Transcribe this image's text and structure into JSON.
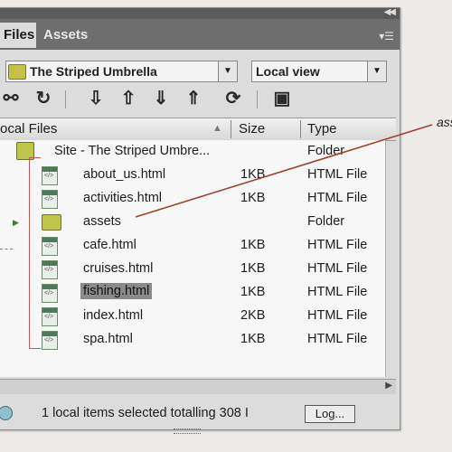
{
  "panel": {
    "tabs": [
      {
        "label": "Files"
      },
      {
        "label": "Assets"
      }
    ],
    "site_select": {
      "value": "The Striped Umbrella"
    },
    "view_select": {
      "value": "Local view"
    }
  },
  "toolbar": {
    "buttons": [
      "connect-icon",
      "refresh-icon",
      "get-files-icon",
      "put-files-icon",
      "check-out-icon",
      "check-in-icon",
      "synchronize-icon",
      "expand-icon"
    ]
  },
  "columns": {
    "name": "ocal Files",
    "size": "Size",
    "type": "Type"
  },
  "files": {
    "site": {
      "name": "Site - The Striped Umbre...",
      "type": "Folder"
    },
    "rows": [
      {
        "name": "about_us.html",
        "size": "1KB",
        "type": "HTML File",
        "icon": "html-file-icon"
      },
      {
        "name": "activities.html",
        "size": "1KB",
        "type": "HTML File",
        "icon": "html-file-icon"
      },
      {
        "name": "assets",
        "size": "",
        "type": "Folder",
        "icon": "folder-icon"
      },
      {
        "name": "cafe.html",
        "size": "1KB",
        "type": "HTML File",
        "icon": "html-file-icon"
      },
      {
        "name": "cruises.html",
        "size": "1KB",
        "type": "HTML File",
        "icon": "html-file-icon"
      },
      {
        "name": "fishing.html",
        "size": "1KB",
        "type": "HTML File",
        "icon": "html-file-icon",
        "selected": true
      },
      {
        "name": "index.html",
        "size": "2KB",
        "type": "HTML File",
        "icon": "html-file-icon"
      },
      {
        "name": "spa.html",
        "size": "1KB",
        "type": "HTML File",
        "icon": "html-file-icon"
      }
    ]
  },
  "status": {
    "text": "1 local items selected totalling 308 I",
    "log_label": "Log..."
  },
  "annotation": {
    "text": "ass",
    "color": "#a0402c"
  }
}
